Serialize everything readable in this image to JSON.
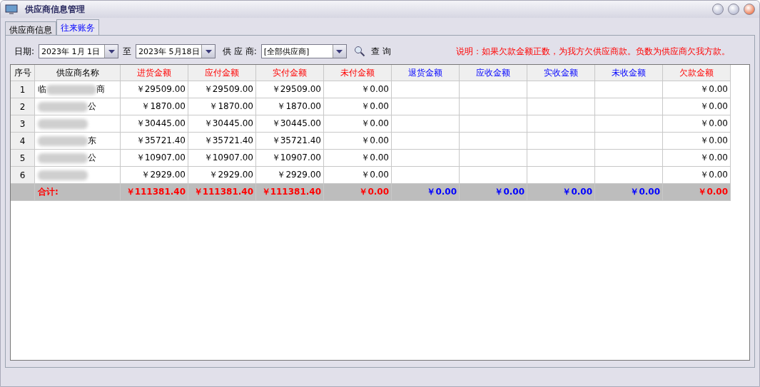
{
  "window": {
    "title": "供应商信息管理"
  },
  "tabs": [
    {
      "label": "供应商信息",
      "selected": false
    },
    {
      "label": "往来账务",
      "selected": true
    }
  ],
  "filters": {
    "date_label": "日期:",
    "date_from": "2023年 1月 1日",
    "to_label": "至",
    "date_to": "2023年 5月18日",
    "supplier_label": "供 应 商:",
    "supplier": "[全部供应商]",
    "query_button": "查 询",
    "note": "说明：如果欠款金额正数，为我方欠供应商款。负数为供应商欠我方款。"
  },
  "table": {
    "columns": [
      {
        "label": "序号",
        "kind": "plain"
      },
      {
        "label": "供应商名称",
        "kind": "plain"
      },
      {
        "label": "进货金额",
        "kind": "payable"
      },
      {
        "label": "应付金额",
        "kind": "payable"
      },
      {
        "label": "实付金额",
        "kind": "payable"
      },
      {
        "label": "未付金额",
        "kind": "payable"
      },
      {
        "label": "退货金额",
        "kind": "receivable"
      },
      {
        "label": "应收金额",
        "kind": "receivable"
      },
      {
        "label": "实收金额",
        "kind": "receivable"
      },
      {
        "label": "未收金额",
        "kind": "receivable"
      },
      {
        "label": "欠款金额",
        "kind": "payable"
      }
    ],
    "rows": [
      {
        "cells": [
          "1",
          "临 商",
          "￥29509.00",
          "￥29509.00",
          "￥29509.00",
          "￥0.00",
          "",
          "",
          "",
          "",
          "￥0.00"
        ]
      },
      {
        "cells": [
          "2",
          "公",
          "￥1870.00",
          "￥1870.00",
          "￥1870.00",
          "￥0.00",
          "",
          "",
          "",
          "",
          "￥0.00"
        ]
      },
      {
        "cells": [
          "3",
          "",
          "￥30445.00",
          "￥30445.00",
          "￥30445.00",
          "￥0.00",
          "",
          "",
          "",
          "",
          "￥0.00"
        ]
      },
      {
        "cells": [
          "4",
          "东",
          "￥35721.40",
          "￥35721.40",
          "￥35721.40",
          "￥0.00",
          "",
          "",
          "",
          "",
          "￥0.00"
        ]
      },
      {
        "cells": [
          "5",
          "公",
          "￥10907.00",
          "￥10907.00",
          "￥10907.00",
          "￥0.00",
          "",
          "",
          "",
          "",
          "￥0.00"
        ]
      },
      {
        "cells": [
          "6",
          "",
          "￥2929.00",
          "￥2929.00",
          "￥2929.00",
          "￥0.00",
          "",
          "",
          "",
          "",
          "￥0.00"
        ]
      }
    ],
    "total": {
      "cells": [
        "",
        "合计:",
        "￥111381.40",
        "￥111381.40",
        "￥111381.40",
        "￥0.00",
        "￥0.00",
        "￥0.00",
        "￥0.00",
        "￥0.00",
        "￥0.00"
      ]
    }
  }
}
